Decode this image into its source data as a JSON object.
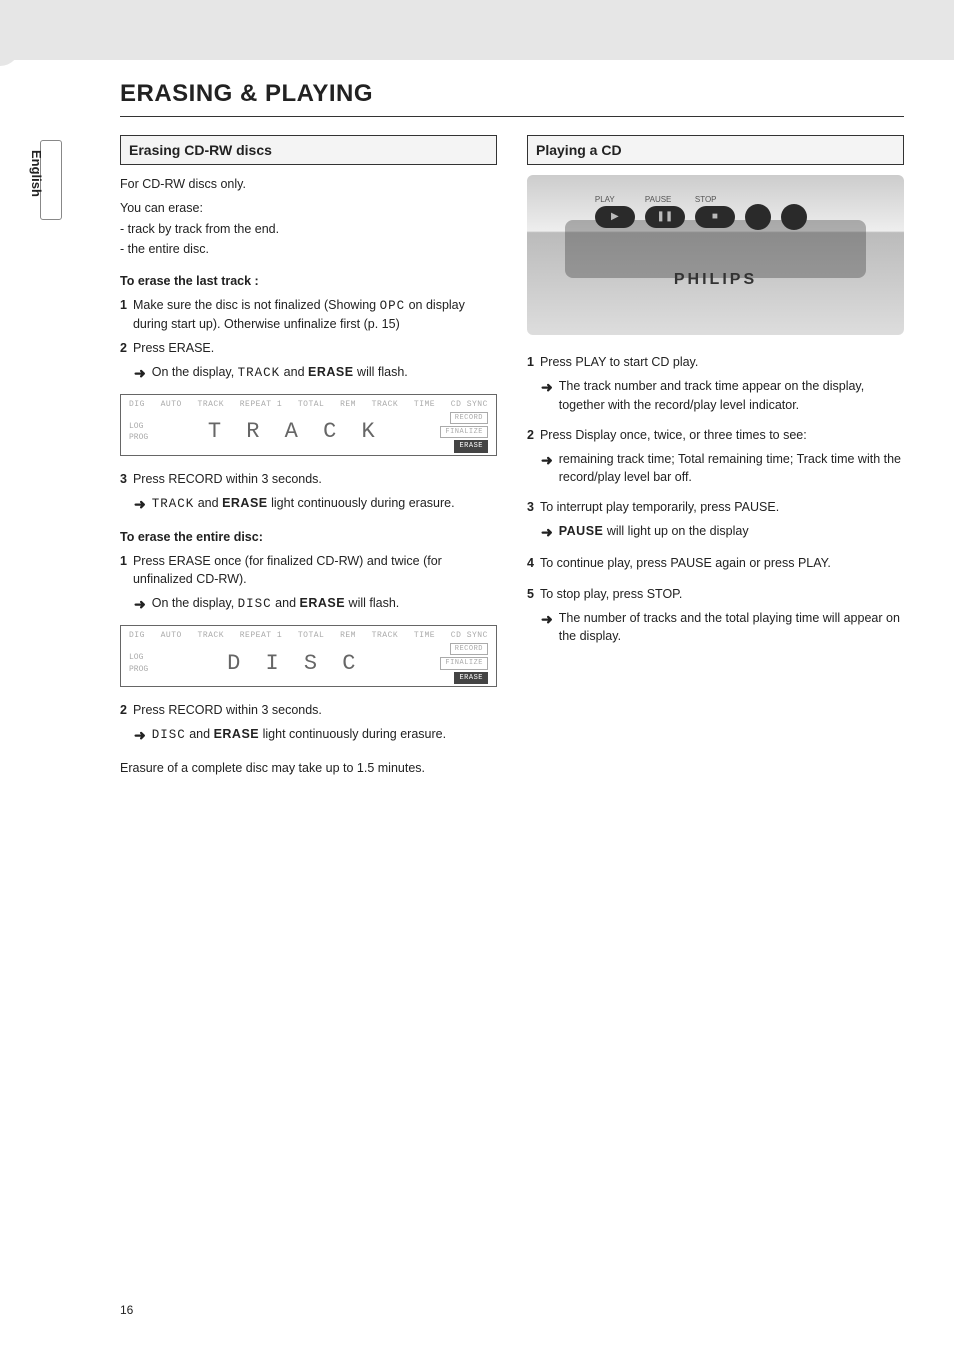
{
  "header": {
    "title": "ERASING & PLAYING"
  },
  "side_tab": {
    "language": "English"
  },
  "left": {
    "section_title": "Erasing CD-RW discs",
    "intro": "For CD-RW discs only.",
    "can_erase_label": "You can erase:",
    "can_erase_items": [
      "- track by track from the end.",
      "- the entire disc."
    ],
    "last_track": {
      "heading": "To erase the last track :",
      "step1_num": "1",
      "step1_a": "Make sure the disc is not finalized (Showing ",
      "step1_opc": "OPC",
      "step1_b": " on display during start up). Otherwise unfinalize first (p. 15)",
      "step2_num": "2",
      "step2_text": "Press ERASE.",
      "step2_arrow_a": "On the display, ",
      "step2_arrow_mono": "TRACK",
      "step2_arrow_b": "   and ",
      "step2_arrow_bold": "ERASE",
      "step2_arrow_c": " will flash.",
      "lcd_readout": "T R A C K",
      "step3_num": "3",
      "step3_text": "Press RECORD within 3 seconds.",
      "step3_arrow_mono": "TRACK",
      "step3_arrow_b": " and ",
      "step3_arrow_bold": "ERASE",
      "step3_arrow_c": " light continuously during erasure."
    },
    "entire_disc": {
      "heading": "To erase the entire disc:",
      "step1_num": "1",
      "step1_text": "Press ERASE once (for finalized CD-RW) and twice (for unfinalized CD-RW).",
      "step1_arrow_a": "On the display, ",
      "step1_arrow_mono": "DISC",
      "step1_arrow_b": " and ",
      "step1_arrow_bold": "ERASE",
      "step1_arrow_c": " will flash.",
      "lcd_readout": "D I S C",
      "step2_num": "2",
      "step2_text": "Press RECORD within 3 seconds.",
      "step2_arrow_mono": "DISC",
      "step2_arrow_b": " and ",
      "step2_arrow_bold": "ERASE",
      "step2_arrow_c": " light continuously during erasure.",
      "footer_note": "Erasure of a complete disc may take up to 1.5 minutes."
    }
  },
  "right": {
    "section_title": "Playing a CD",
    "device_brand": "PHILIPS",
    "step1_num": "1",
    "step1_text": "Press PLAY to start CD play.",
    "step1_arrow": "The track number and track time appear on the display, together with the record/play level indicator.",
    "step2_num": "2",
    "step2_text": "Press Display once, twice, or three times to see:",
    "step2_arrow": "remaining track time; Total remaining time; Track time with the record/play level bar off.",
    "step3_num": "3",
    "step3_text": "To interrupt play temporarily, press PAUSE.",
    "step3_arrow_bold": "PAUSE",
    "step3_arrow_rest": " will light up on the display",
    "step4_num": "4",
    "step4_text": "To continue play, press PAUSE again or press PLAY.",
    "step5_num": "5",
    "step5_text": "To stop play, press STOP.",
    "step5_arrow": "The number of tracks and the total playing time will appear on the display."
  },
  "lcd_labels": {
    "top": [
      "DIG",
      "AUTO",
      "TRACK",
      "REPEAT 1",
      "TOTAL",
      "REM",
      "TRACK",
      "TIME",
      "CD SYNC"
    ],
    "left_top": "LOG",
    "left_bottom": "PROG",
    "badges": [
      "RECORD",
      "FINALIZE",
      "ERASE"
    ]
  },
  "page_number": "16"
}
